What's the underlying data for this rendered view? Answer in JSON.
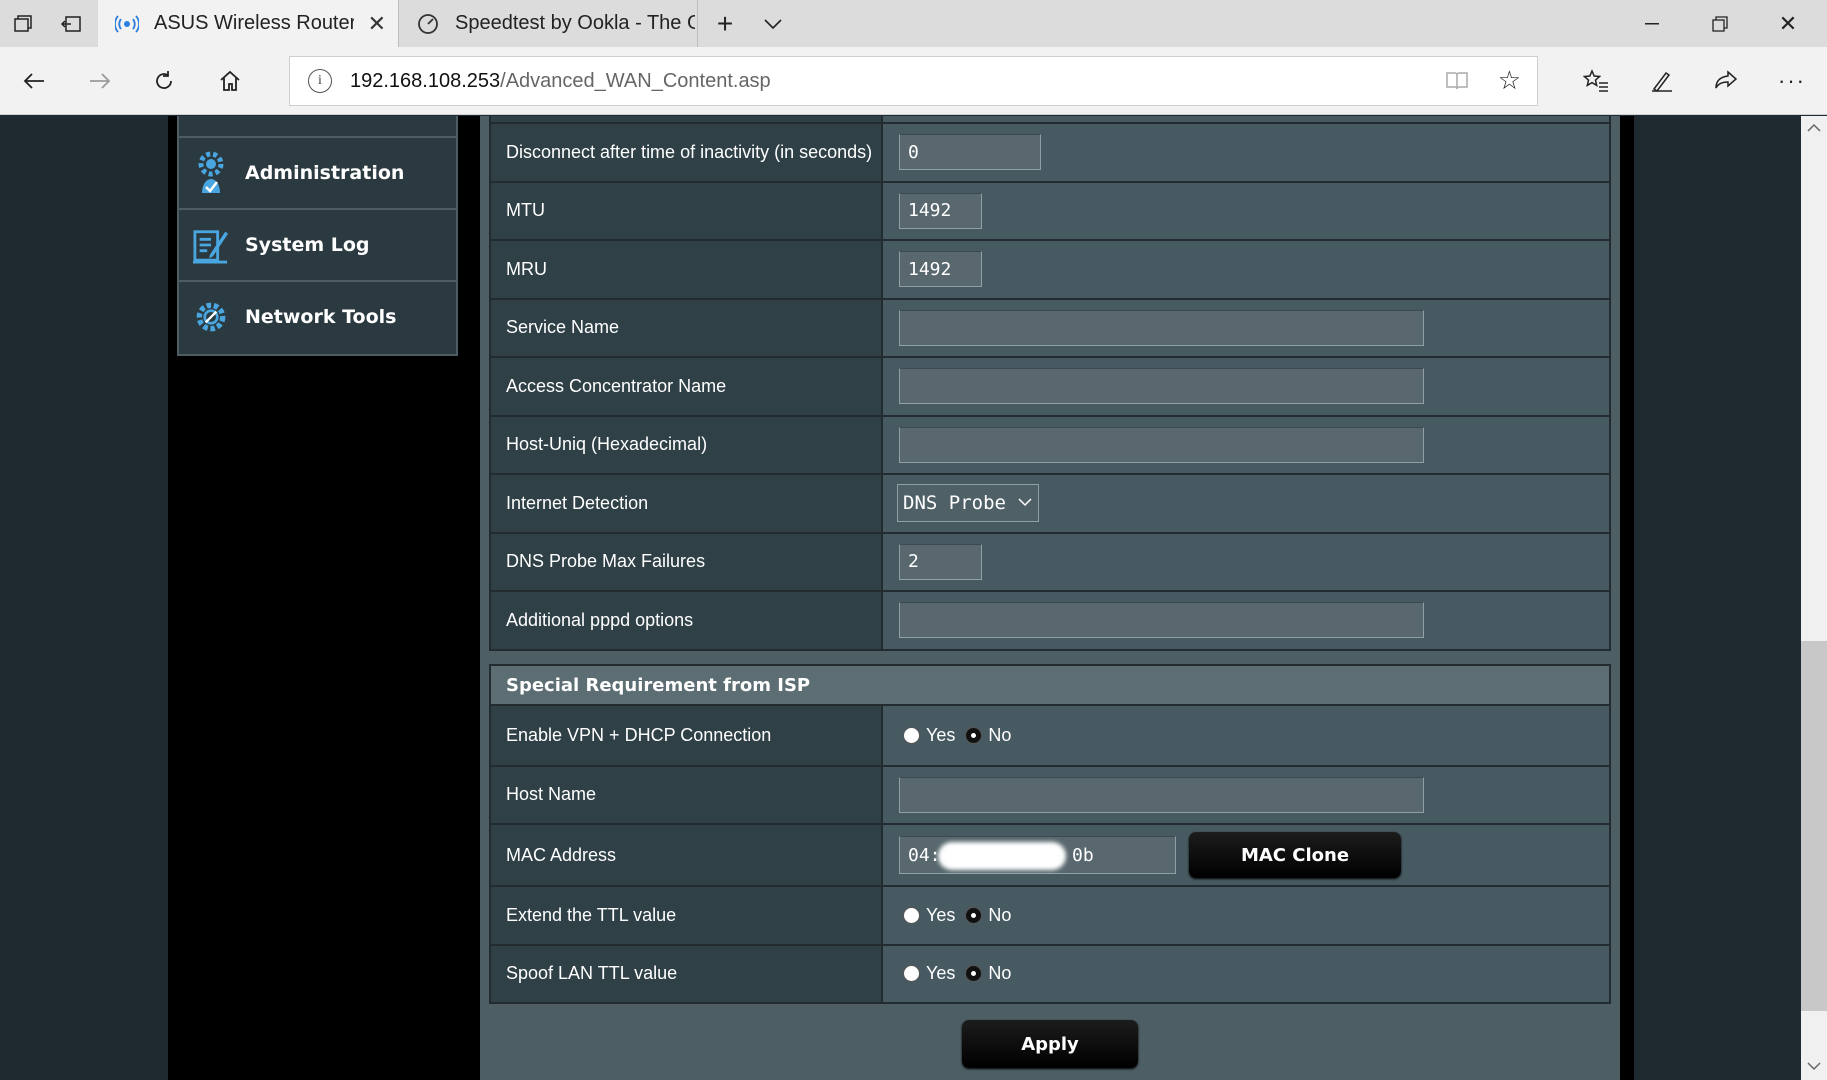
{
  "browser": {
    "tabs": [
      {
        "title": "ASUS Wireless Router R",
        "active": true
      },
      {
        "title": "Speedtest by Ookla - The G",
        "active": false
      }
    ],
    "url_host": "192.168.108.253",
    "url_path": "/Advanced_WAN_Content.asp"
  },
  "sidebar": {
    "items": [
      {
        "label": "Administration",
        "icon": "gear-person-icon"
      },
      {
        "label": "System Log",
        "icon": "log-edit-icon"
      },
      {
        "label": "Network Tools",
        "icon": "network-gear-icon"
      }
    ]
  },
  "wan": {
    "rows": [
      {
        "label": "Disconnect after time of inactivity (in seconds)",
        "value": "0"
      },
      {
        "label": "MTU",
        "value": "1492"
      },
      {
        "label": "MRU",
        "value": "1492"
      },
      {
        "label": "Service Name",
        "value": ""
      },
      {
        "label": "Access Concentrator Name",
        "value": ""
      },
      {
        "label": "Host-Uniq (Hexadecimal)",
        "value": ""
      },
      {
        "label": "Internet Detection",
        "value": "DNS Probe"
      },
      {
        "label": "DNS Probe Max Failures",
        "value": "2"
      },
      {
        "label": "Additional pppd options",
        "value": ""
      }
    ]
  },
  "isp": {
    "title": "Special Requirement from ISP",
    "vpn_dhcp_label": "Enable VPN + DHCP Connection",
    "host_name_label": "Host Name",
    "host_name_value": "",
    "mac_label": "MAC Address",
    "mac_value_prefix": "04:",
    "mac_value_suffix": "0b",
    "mac_clone": "MAC Clone",
    "ttl_label": "Extend the TTL value",
    "spoof_label": "Spoof LAN TTL value",
    "yes": "Yes",
    "no": "No",
    "apply": "Apply"
  },
  "colors": {
    "panel": "#4d5e64",
    "label_bg": "#2f4047",
    "value_bg": "#475a61",
    "button": "#000000"
  }
}
